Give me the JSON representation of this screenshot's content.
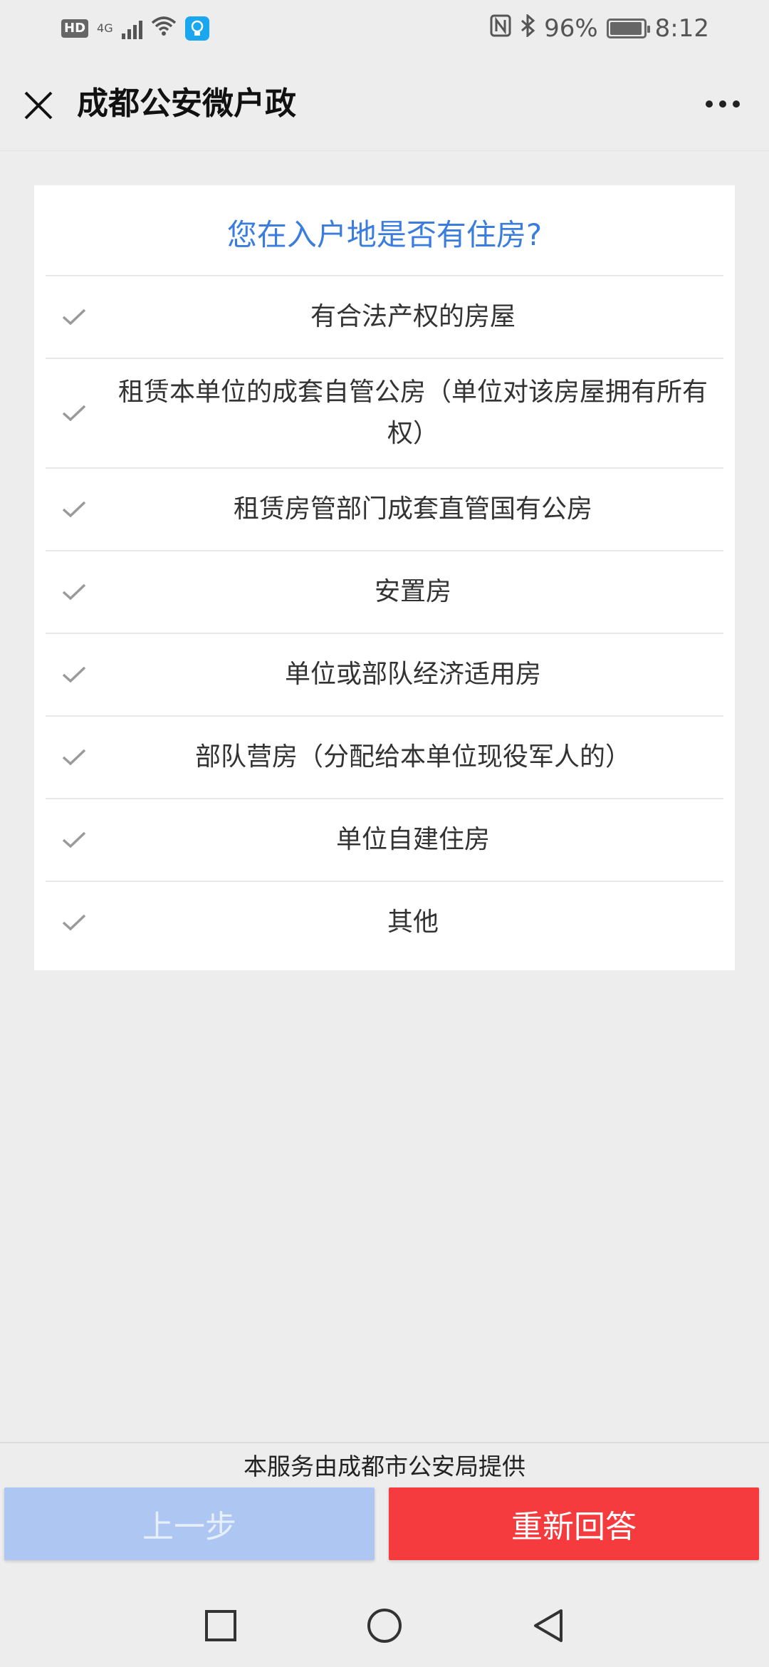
{
  "status_bar": {
    "hd": "HD",
    "network": "4G",
    "nfc": "N",
    "battery_percent": "96%",
    "battery_level": 0.96,
    "time": "8:12"
  },
  "header": {
    "title": "成都公安微户政",
    "close_icon": "close-icon",
    "more_icon": "more-icon"
  },
  "question": {
    "text": "您在入户地是否有住房?"
  },
  "options": [
    {
      "label": "有合法产权的房屋"
    },
    {
      "label": "租赁本单位的成套自管公房（单位对该房屋拥有所有权）"
    },
    {
      "label": "租赁房管部门成套直管国有公房"
    },
    {
      "label": "安置房"
    },
    {
      "label": "单位或部队经济适用房"
    },
    {
      "label": "部队营房（分配给本单位现役军人的）"
    },
    {
      "label": "单位自建住房"
    },
    {
      "label": "其他"
    }
  ],
  "footer": {
    "provider": "本服务由成都市公安局提供",
    "prev_label": "上一步",
    "restart_label": "重新回答"
  },
  "colors": {
    "accent": "#3b7ddd",
    "prev_button": "#adc7f2",
    "restart_button": "#f53b3d",
    "background": "#ededed"
  }
}
